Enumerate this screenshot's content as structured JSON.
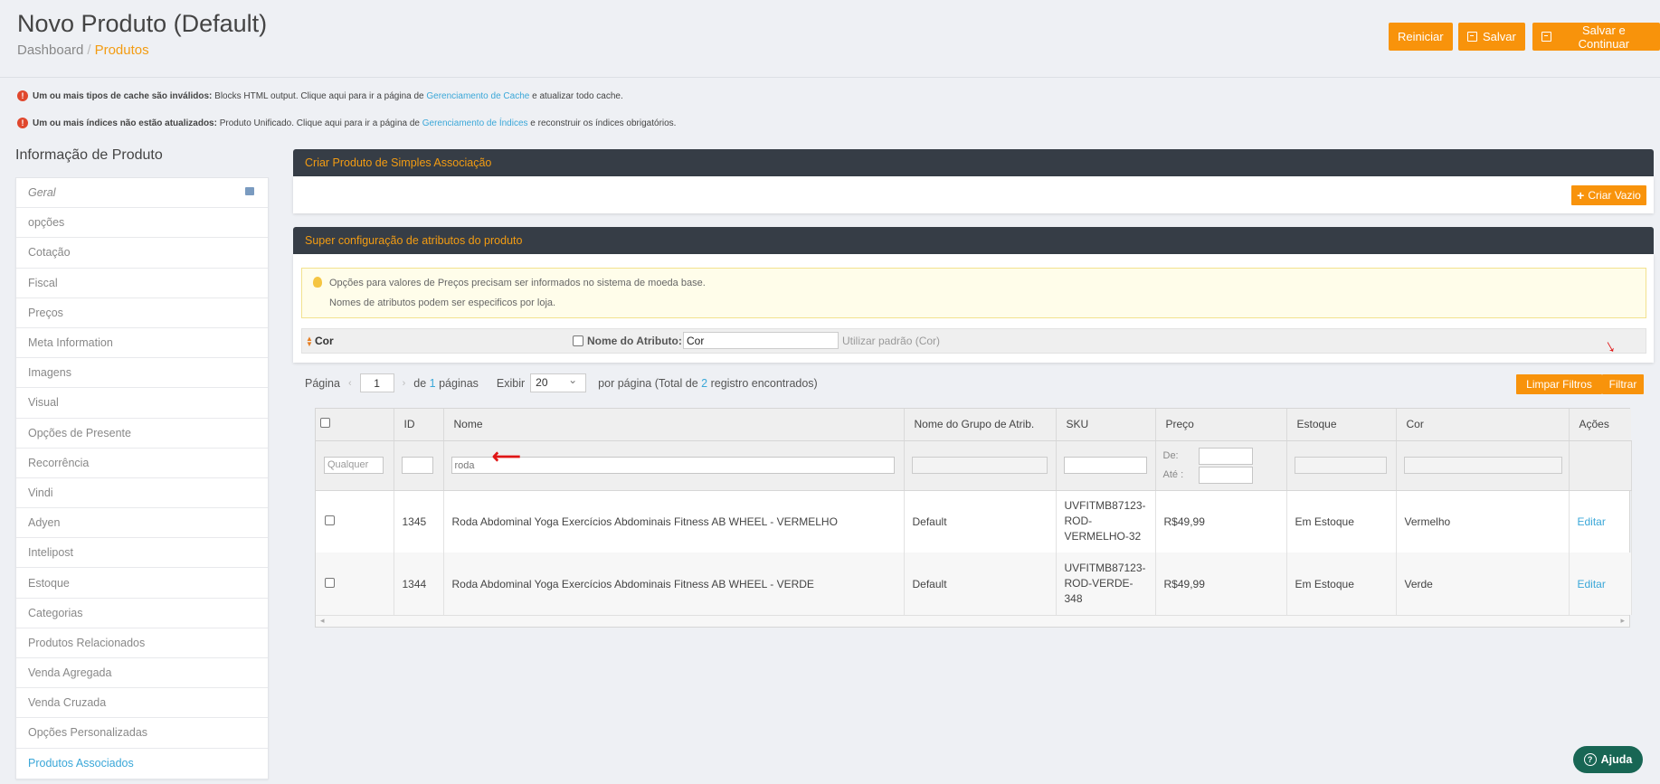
{
  "header": {
    "title": "Novo Produto (Default)",
    "breadcrumb": {
      "parent": "Dashboard",
      "separator": "/",
      "current": "Produtos"
    },
    "buttons": {
      "reset": "Reiniciar",
      "save": "Salvar",
      "save_continue": "Salvar e Continuar"
    }
  },
  "notices": [
    {
      "bold": "Um ou mais tipos de cache são inválidos:",
      "text": " Blocks HTML output. Clique aqui para ir a página de ",
      "link": "Gerenciamento de Cache",
      "tail": " e atualizar todo cache."
    },
    {
      "bold": "Um ou mais índices não estão atualizados:",
      "text": " Produto Unificado. Clique aqui para ir a página de ",
      "link": "Gerenciamento de Índices",
      "tail": " e reconstruir os índices obrigatórios."
    }
  ],
  "sidebar": {
    "title": "Informação de Produto",
    "items": [
      "Geral",
      "opções",
      "Cotação",
      "Fiscal",
      "Preços",
      "Meta Information",
      "Imagens",
      "Visual",
      "Opções de Presente",
      "Recorrência",
      "Vindi",
      "Adyen",
      "Intelipost",
      "Estoque",
      "Categorias",
      "Produtos Relacionados",
      "Venda Agregada",
      "Venda Cruzada",
      "Opções Personalizadas",
      "Produtos Associados"
    ]
  },
  "simple_panel": {
    "title": "Criar Produto de Simples Associação",
    "create_empty": "Criar Vazio"
  },
  "super_panel": {
    "title": "Super configuração de atributos do produto",
    "info_line1": "Opções para valores de Preços precisam ser informados no sistema de moeda base.",
    "info_line2": "Nomes de atributos podem ser especificos por loja.",
    "attribute": {
      "code": "Cor",
      "name_label": "Nome do Atributo:",
      "name_value": "Cor",
      "default_text": "Utilizar padrão (Cor)"
    }
  },
  "pager": {
    "page_label": "Página",
    "page_value": "1",
    "of_label": "de",
    "total_pages": "1",
    "pages_label": "páginas",
    "show_label": "Exibir",
    "per_page": "20",
    "per_page_label": "por página (Total de",
    "total_records": "2",
    "records_label": "registro encontrados)",
    "reset_filters": "Limpar Filtros",
    "filter": "Filtrar"
  },
  "grid": {
    "columns": [
      "",
      "ID",
      "Nome",
      "Nome do Grupo de Atrib.",
      "SKU",
      "Preço",
      "Estoque",
      "Cor",
      "Ações"
    ],
    "filters": {
      "any": "Qualquer",
      "name": "roda",
      "price_from": "De:",
      "price_to": "Até :"
    },
    "rows": [
      {
        "id": "1345",
        "name": "Roda Abdominal Yoga Exercícios Abdominais Fitness AB WHEEL - VERMELHO",
        "group": "Default",
        "sku": [
          "UVFITMB87123-",
          "ROD-",
          "VERMELHO-32"
        ],
        "price": "R$49,99",
        "stock": "Em Estoque",
        "color": "Vermelho",
        "action": "Editar"
      },
      {
        "id": "1344",
        "name": "Roda Abdominal Yoga Exercícios Abdominais Fitness AB WHEEL - VERDE",
        "group": "Default",
        "sku": [
          "UVFITMB87123-",
          "ROD-VERDE-",
          "348"
        ],
        "price": "R$49,99",
        "stock": "Em Estoque",
        "color": "Verde",
        "action": "Editar"
      }
    ]
  },
  "help": {
    "label": "Ajuda"
  },
  "colors": {
    "accent": "#f8930b",
    "panel_header": "#363d46",
    "link": "#3aa7d8",
    "help": "#186654"
  }
}
